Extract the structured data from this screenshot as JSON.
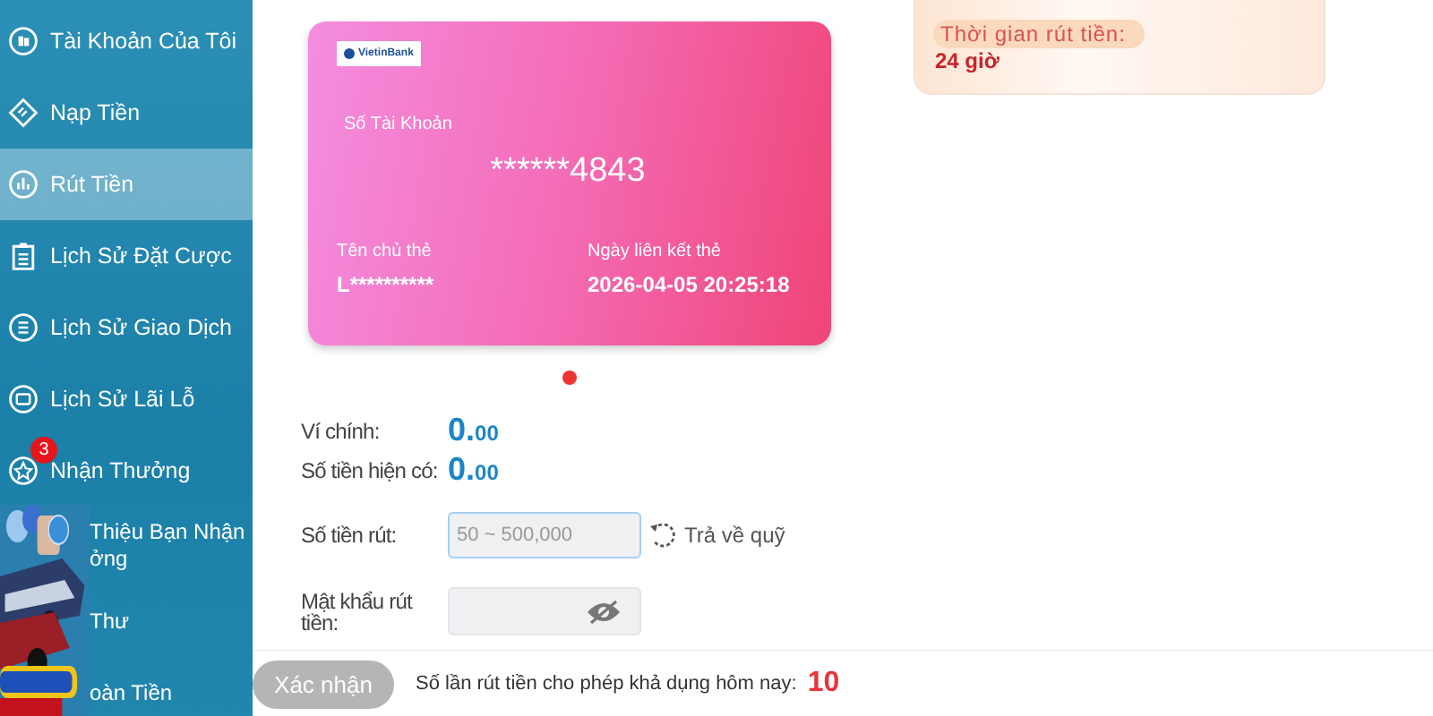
{
  "sidebar": {
    "items": [
      {
        "label": "Tài Khoản Của Tôi",
        "kind": "account",
        "selected": false
      },
      {
        "label": "Nạp Tiền",
        "kind": "deposit",
        "selected": false
      },
      {
        "label": "Rút Tiền",
        "kind": "withdraw",
        "selected": true
      },
      {
        "label": "Lịch Sử Đặt Cược",
        "kind": "bets",
        "selected": false
      },
      {
        "label": "Lịch Sử Giao Dịch",
        "kind": "transactions",
        "selected": false
      },
      {
        "label": "Lịch Sử Lãi Lỗ",
        "kind": "profit",
        "selected": false
      },
      {
        "label": "Nhận Thưởng",
        "kind": "reward",
        "selected": false,
        "badge": "3"
      },
      {
        "label": "Thiệu Bạn Nhận",
        "label_line_2": "ởng",
        "kind": "covered",
        "selected": false
      },
      {
        "label": "Thư",
        "kind": "covered",
        "selected": false
      },
      {
        "label": "oàn Tiền",
        "kind": "covered",
        "selected": false
      }
    ]
  },
  "bank_card": {
    "bank_logo": "VietinBank",
    "account_label": "Số Tài Khoản",
    "account_number": "******4843",
    "holder_label": "Tên chủ thẻ",
    "holder_name": "L**********",
    "linked_label": "Ngày liên kết thẻ",
    "linked_date": "2026-04-05 20:25:18"
  },
  "carousel_dots": [
    {
      "selected": true
    }
  ],
  "withdraw_time": {
    "label": "Thời gian rút tiền:",
    "value": "24 giờ"
  },
  "form": {
    "main_wallet_label": "Ví chính:",
    "main_wallet_value": "0.",
    "main_wallet_decimals": "00",
    "balance_label": "Số tiền hiện có:",
    "balance_value": "0.",
    "balance_decimals": "00",
    "amount_label": "Số tiền rút:",
    "amount_placeholder": "50 ~ 500,000",
    "return_link": "Trả về quỹ",
    "password_label": "Mật khẩu rút tiền:"
  },
  "footer": {
    "confirm_button": "Xác nhận",
    "confirm_disabled": true,
    "limit_label": "Số lần rút tiền cho phép khả dụng hôm nay:",
    "limit_value": "10"
  }
}
